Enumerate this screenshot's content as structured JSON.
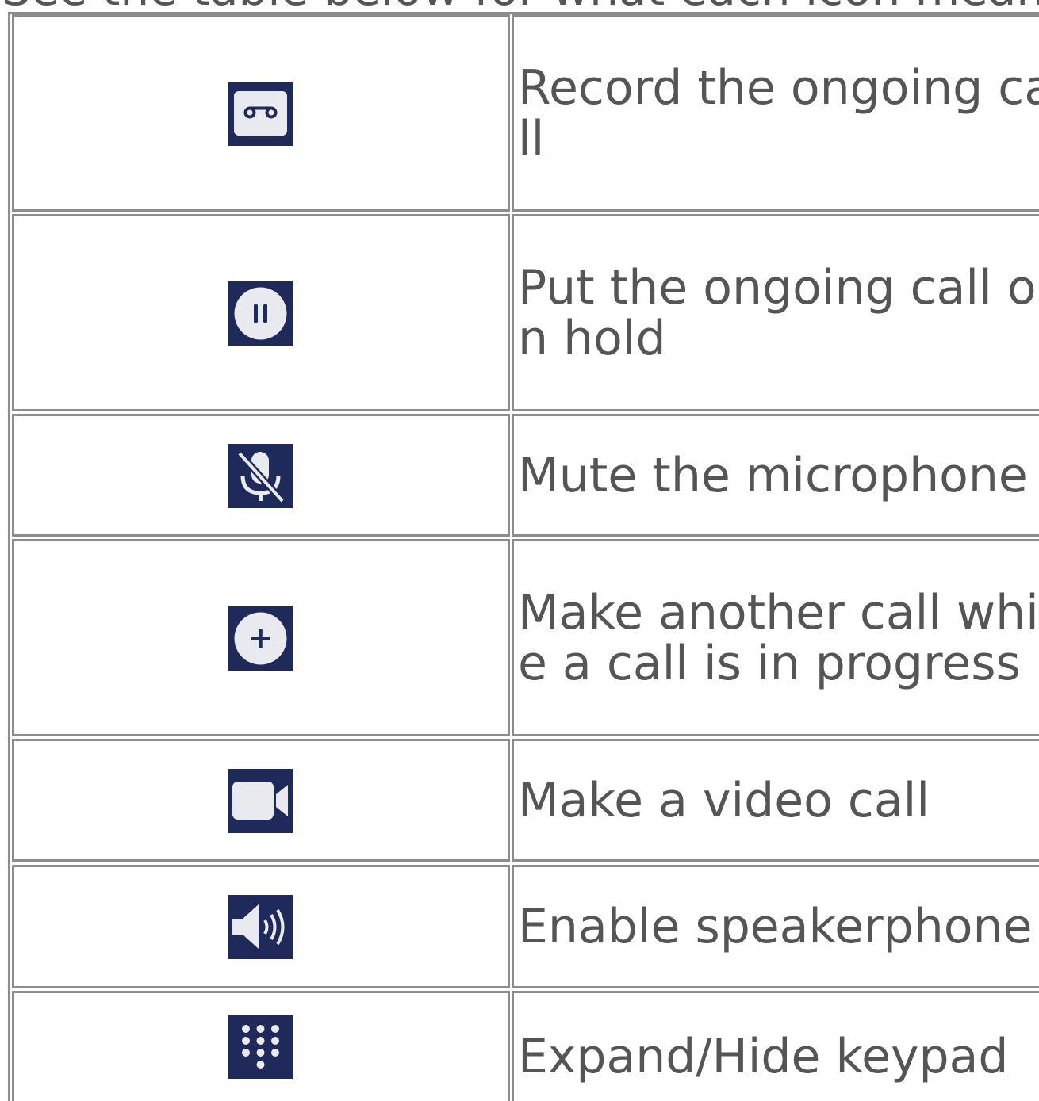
{
  "intro_text": "See the table below for what each icon means.",
  "colors": {
    "icon_background": "#1f2a5a",
    "icon_foreground": "#e9eaf0",
    "border": "#8c8c8c",
    "text": "#555555"
  },
  "rows": [
    {
      "icon": "record-icon",
      "description": "Record the ongoing ca\nll"
    },
    {
      "icon": "hold-icon",
      "description": "Put the ongoing call o\nn hold"
    },
    {
      "icon": "mute-microphone-icon",
      "description": "Mute the microphone"
    },
    {
      "icon": "add-call-icon",
      "description": "Make another call whil\ne a call is in progress"
    },
    {
      "icon": "video-call-icon",
      "description": "Make a video call"
    },
    {
      "icon": "speakerphone-icon",
      "description": "Enable speakerphone"
    },
    {
      "icon": "keypad-icon",
      "description": "Expand/Hide keypad"
    }
  ]
}
